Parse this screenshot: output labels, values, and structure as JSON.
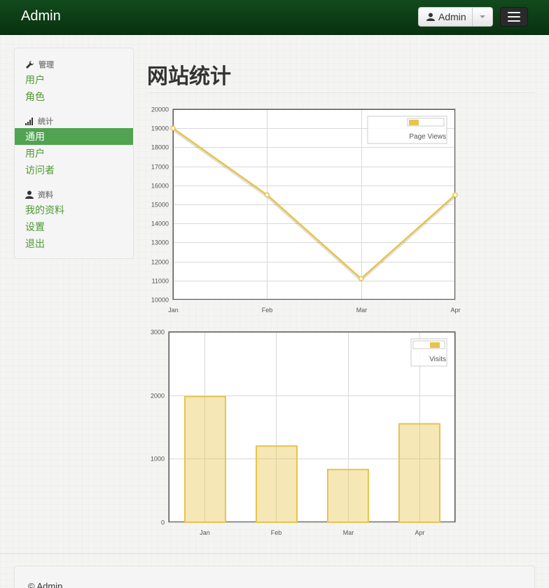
{
  "navbar": {
    "brand": "Admin",
    "user_label": "Admin"
  },
  "sidebar": {
    "sections": [
      {
        "header": "管理",
        "icon": "wrench-icon",
        "items": [
          "用户",
          "角色"
        ]
      },
      {
        "header": "统计",
        "icon": "signal-icon",
        "items": [
          "通用",
          "用户",
          "访问者"
        ]
      },
      {
        "header": "资料",
        "icon": "user-icon",
        "items": [
          "我的资料",
          "设置",
          "退出"
        ]
      }
    ],
    "active_item": "通用"
  },
  "page": {
    "title": "网站统计"
  },
  "footer": {
    "text": "© Admin"
  },
  "colors": {
    "series": "#e8c44a",
    "active": "#51a351",
    "link": "#4e9a32"
  },
  "chart_data": [
    {
      "type": "line",
      "categories": [
        "Jan",
        "Feb",
        "Mar",
        "Apr"
      ],
      "series": [
        {
          "name": "Page Views",
          "values": [
            19000,
            15500,
            11100,
            15500
          ]
        }
      ],
      "ylim": [
        10000,
        20000
      ],
      "yticks": [
        10000,
        11000,
        12000,
        13000,
        14000,
        15000,
        16000,
        17000,
        18000,
        19000,
        20000
      ],
      "grid": true,
      "legend": "top-right"
    },
    {
      "type": "bar",
      "categories": [
        "Jan",
        "Feb",
        "Mar",
        "Apr"
      ],
      "series": [
        {
          "name": "Visits",
          "values": [
            1980,
            1200,
            830,
            1550
          ]
        }
      ],
      "ylim": [
        0,
        3000
      ],
      "yticks": [
        0,
        1000,
        2000,
        3000
      ],
      "grid": true,
      "legend": "top-right"
    }
  ]
}
